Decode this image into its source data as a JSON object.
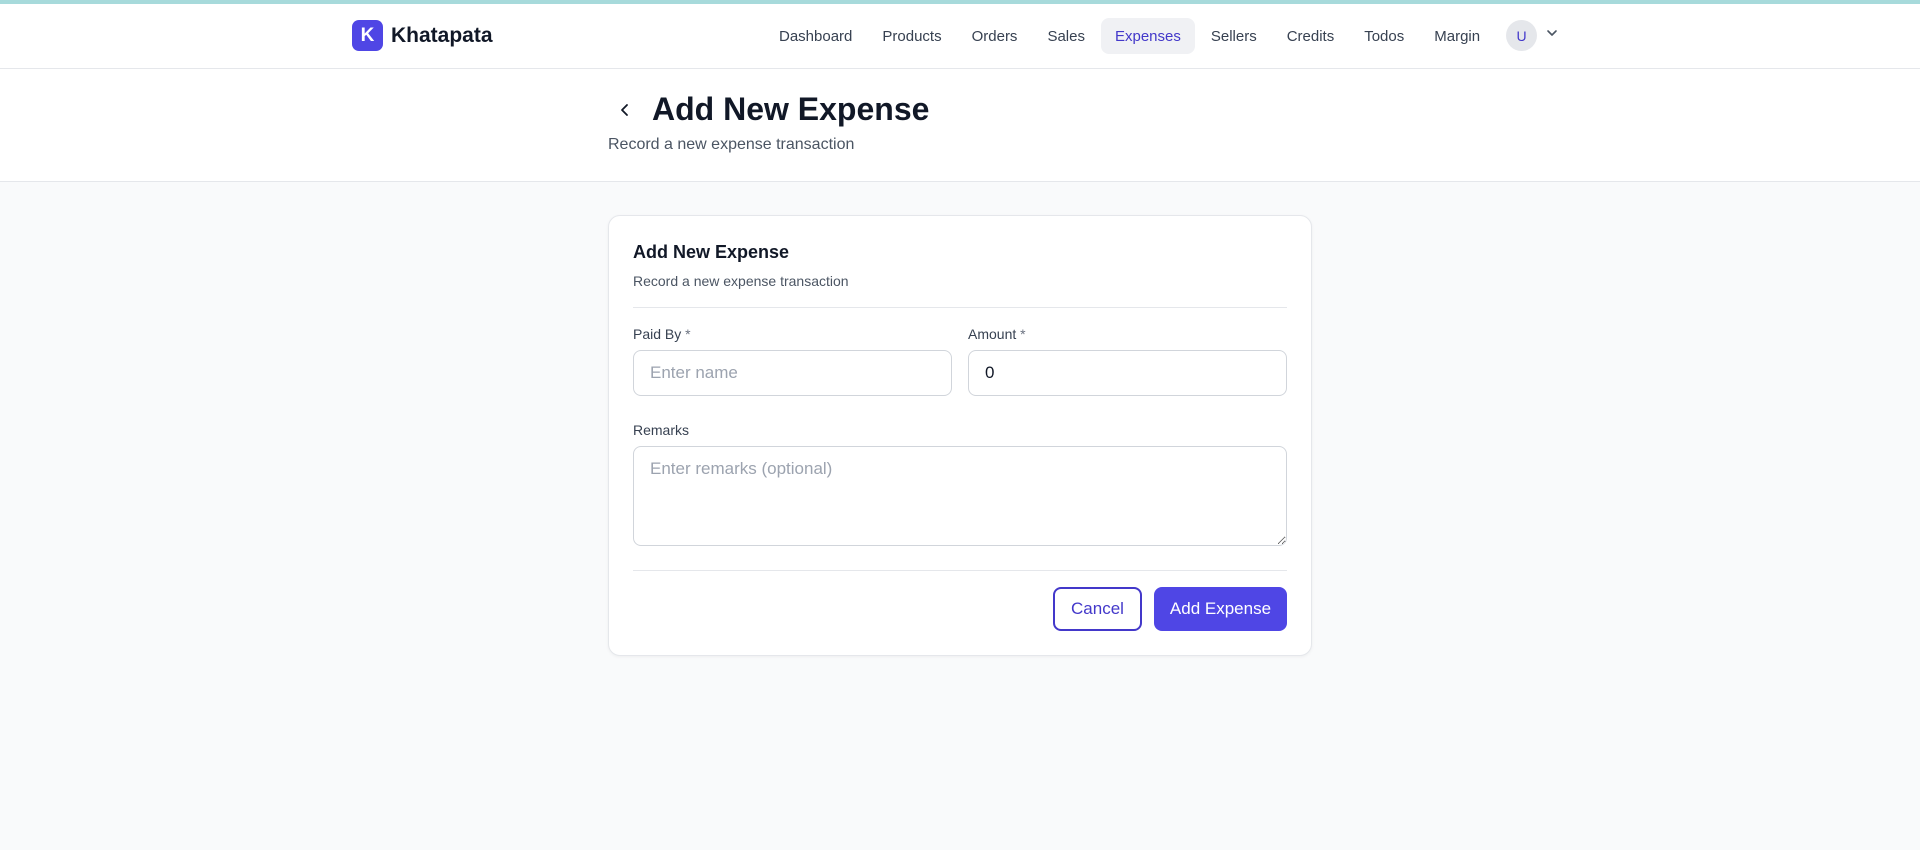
{
  "app": {
    "logo_letter": "K",
    "name": "Khatapata",
    "brand_color": "#4f46e5"
  },
  "nav": {
    "items": [
      {
        "label": "Dashboard",
        "active": false
      },
      {
        "label": "Products",
        "active": false
      },
      {
        "label": "Orders",
        "active": false
      },
      {
        "label": "Sales",
        "active": false
      },
      {
        "label": "Expenses",
        "active": true
      },
      {
        "label": "Sellers",
        "active": false
      },
      {
        "label": "Credits",
        "active": false
      },
      {
        "label": "Todos",
        "active": false
      },
      {
        "label": "Margin",
        "active": false
      }
    ],
    "user_initial": "U",
    "user_menu_icon": "chevron-down-icon"
  },
  "header": {
    "back_icon": "chevron-left-icon",
    "title": "Add New Expense",
    "subtitle": "Record a new expense transaction"
  },
  "form": {
    "title": "Add New Expense",
    "subtitle": "Record a new expense transaction",
    "paid_by": {
      "label": "Paid By",
      "required_mark": "*",
      "value": "",
      "placeholder": "Enter name"
    },
    "amount": {
      "label": "Amount",
      "required_mark": "*",
      "value": "0",
      "placeholder": ""
    },
    "remarks": {
      "label": "Remarks",
      "value": "",
      "placeholder": "Enter remarks (optional)"
    },
    "cancel_label": "Cancel",
    "submit_label": "Add Expense"
  }
}
